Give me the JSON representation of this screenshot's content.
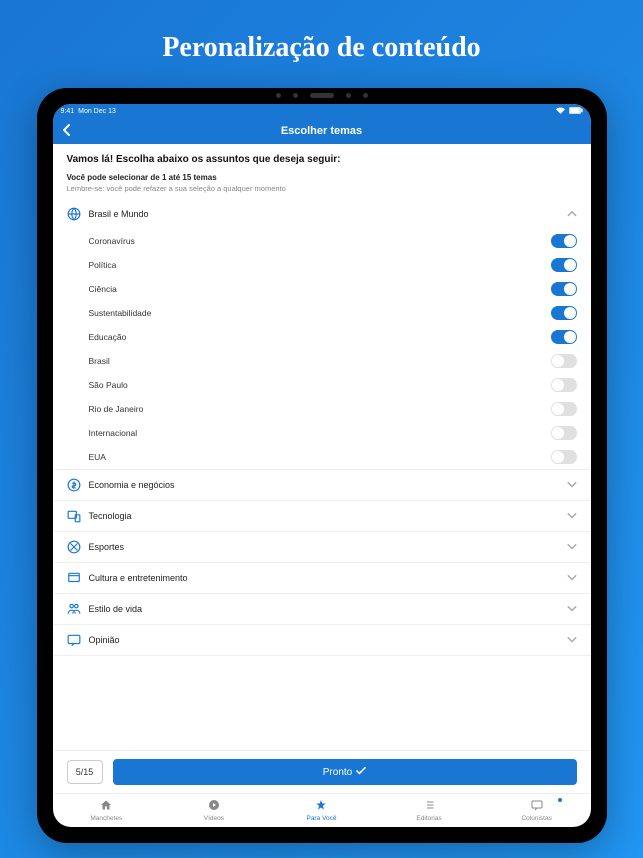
{
  "promo": {
    "title": "Peronalização de conteúdo"
  },
  "status": {
    "time": "9:41",
    "date": "Mon Dec 13"
  },
  "nav": {
    "title": "Escolher temas"
  },
  "instructions": {
    "main": "Vamos lá! Escolha abaixo os assuntos que deseja seguir:",
    "sub": "Você pode selecionar de 1 até 15 temas",
    "hint": "Lembre-se: você pode refazer a sua seleção a qualquer momento"
  },
  "categories": [
    {
      "label": "Brasil e Mundo",
      "icon": "globe",
      "expanded": true,
      "topics": [
        {
          "label": "Coronavírus",
          "on": true
        },
        {
          "label": "Política",
          "on": true
        },
        {
          "label": "Ciência",
          "on": true
        },
        {
          "label": "Sustentabilidade",
          "on": true
        },
        {
          "label": "Educação",
          "on": true
        },
        {
          "label": "Brasil",
          "on": false
        },
        {
          "label": "São Paulo",
          "on": false
        },
        {
          "label": "Rio de Janeiro",
          "on": false
        },
        {
          "label": "Internacional",
          "on": false
        },
        {
          "label": "EUA",
          "on": false
        }
      ]
    },
    {
      "label": "Economia e negócios",
      "icon": "dollar",
      "expanded": false
    },
    {
      "label": "Tecnologia",
      "icon": "devices",
      "expanded": false
    },
    {
      "label": "Esportes",
      "icon": "sports",
      "expanded": false
    },
    {
      "label": "Cultura e entretenimento",
      "icon": "culture",
      "expanded": false
    },
    {
      "label": "Estilo de vida",
      "icon": "lifestyle",
      "expanded": false
    },
    {
      "label": "Opinião",
      "icon": "opinion",
      "expanded": false
    }
  ],
  "footer": {
    "counter": "5/15",
    "done": "Pronto"
  },
  "tabs": [
    {
      "label": "Manchetes",
      "icon": "home",
      "active": false
    },
    {
      "label": "Vídeos",
      "icon": "play",
      "active": false
    },
    {
      "label": "Para Você",
      "icon": "star",
      "active": true
    },
    {
      "label": "Editorias",
      "icon": "list",
      "active": false
    },
    {
      "label": "Colunistas",
      "icon": "chat",
      "active": false,
      "badge": true
    }
  ]
}
